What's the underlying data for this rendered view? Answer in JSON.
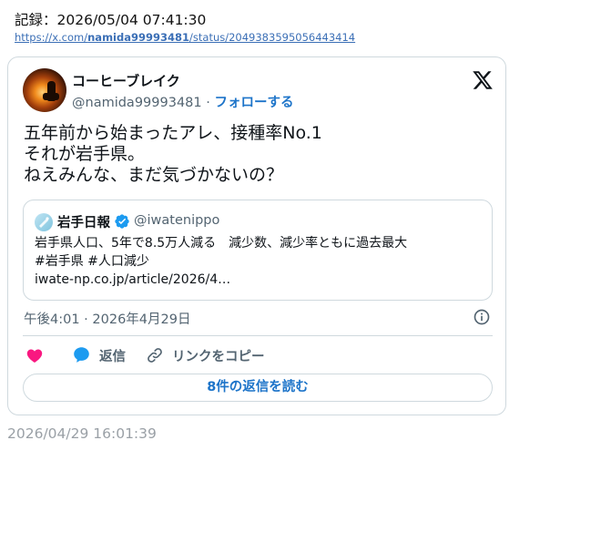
{
  "record": {
    "text": "記録：2026/05/04 07:41:30",
    "url_prefix": "https://x.com/",
    "url_user": "namida99993481",
    "url_suffix": "/status/2049383595056443414"
  },
  "tweet": {
    "display_name": "コーヒーブレイク",
    "handle": "@namida99993481",
    "separator": "·",
    "follow_label": "フォローする",
    "lines": [
      "五年前から始まったアレ、接種率No.1",
      "それが岩手県。",
      "ねえみんな、まだ気づかないの？"
    ],
    "timestamp": "午後4:01 · 2026年4月29日"
  },
  "quote": {
    "display_name": "岩手日報",
    "handle": "@iwatenippo",
    "lines": [
      "岩手県人口、5年で8.5万人減る　減少数、減少率ともに過去最大",
      "#岩手県 #人口減少",
      "iwate-np.co.jp/article/2026/4…"
    ]
  },
  "actions": {
    "reply_label": "返信",
    "copy_link_label": "リンクをコピー",
    "read_replies_label": "8件の返信を読む"
  },
  "footer": {
    "date": "2026/04/29 16:01:39"
  },
  "colors": {
    "accent": "#1d74c9",
    "heart": "#f91880",
    "verified": "#1d9bf0",
    "muted": "#536471"
  },
  "icons": [
    "x-logo-icon",
    "verified-badge-icon",
    "info-icon",
    "heart-icon",
    "reply-bubble-icon",
    "link-icon"
  ]
}
